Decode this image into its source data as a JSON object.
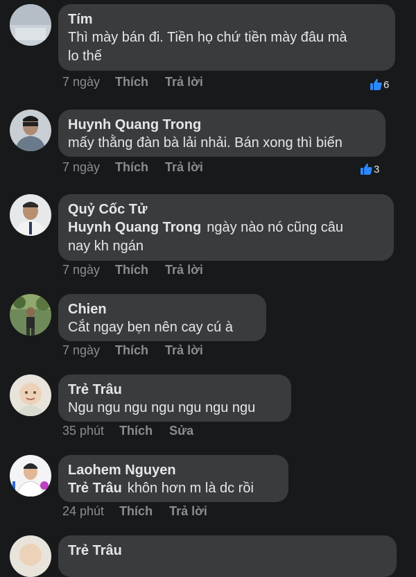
{
  "comments": [
    {
      "author": "Tím",
      "text_line1": "Thì mày bán đi. Tiền họ chứ tiền mày đâu mà",
      "text_line2": "lo thế",
      "time": "7 ngày",
      "like": "Thích",
      "reply": "Trả lời",
      "reactions": "6"
    },
    {
      "author": "Huynh Quang Trong",
      "text": "mấy thằng đàn bà lải nhải. Bán xong thì biến",
      "time": "7 ngày",
      "like": "Thích",
      "reply": "Trả lời",
      "reactions": "3"
    },
    {
      "author": "Quỷ Cốc Tử",
      "mention": "Huynh Quang Trong",
      "text_line1": "ngày nào nó cũng câu",
      "text_line2": "nay kh ngán",
      "time": "7 ngày",
      "like": "Thích",
      "reply": "Trả lời"
    },
    {
      "author": "Chien",
      "text": "Cắt ngay bẹn nên cay cú à",
      "time": "7 ngày",
      "like": "Thích",
      "reply": "Trả lời"
    },
    {
      "author": "Trẻ Trâu",
      "text": "Ngu ngu ngu ngu ngu ngu ngu",
      "time": "35 phút",
      "like": "Thích",
      "edit": "Sửa"
    },
    {
      "author": "Laohem Nguyen",
      "mention": "Trẻ Trâu",
      "text": "khôn hơn m là dc rồi",
      "time": "24 phút",
      "like": "Thích",
      "reply": "Trả lời"
    },
    {
      "author": "Trẻ Trâu"
    }
  ],
  "colors": {
    "background": "#18191a",
    "bubble": "#3a3b3c",
    "meta": "#8a8d91",
    "like_blue": "#2d88ff"
  }
}
